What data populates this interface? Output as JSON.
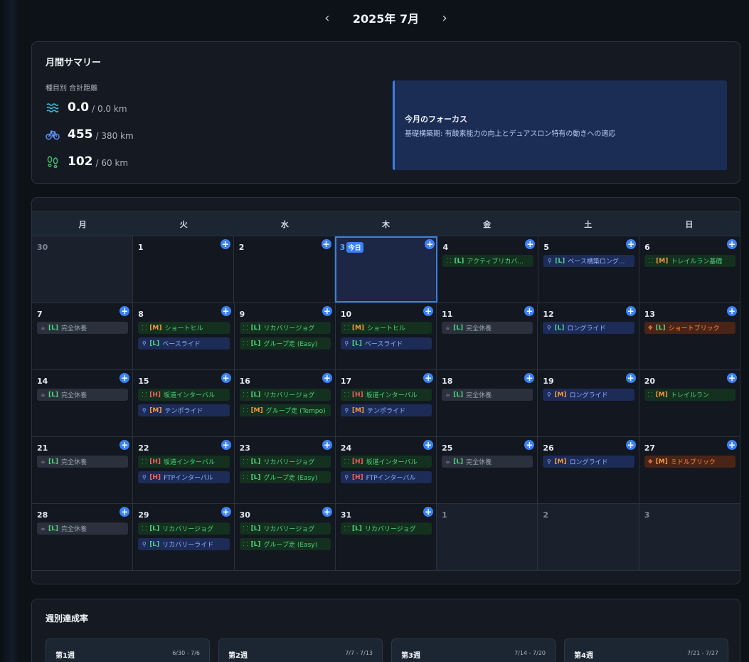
{
  "header": {
    "prev": "‹",
    "title": "2025年 7月",
    "next": "›"
  },
  "summary": {
    "title": "月間サマリー",
    "dist_label": "種目別 合計距離",
    "swim": {
      "value": "0.0",
      "target": "/ 0.0 km",
      "icon": "swim-icon"
    },
    "bike": {
      "value": "455",
      "target": "/ 380 km",
      "icon": "bike-icon"
    },
    "run": {
      "value": "102",
      "target": "/ 60 km",
      "icon": "run-icon"
    },
    "focus_title": "今月のフォーカス",
    "focus_text": "基礎構築期: 有酸素能力の向上とデュアスロン特有の動きへの適応"
  },
  "calendar": {
    "weekdays": [
      "月",
      "火",
      "水",
      "木",
      "金",
      "土",
      "日"
    ],
    "today_label": "今日",
    "add_label": "+",
    "weeks": [
      [
        {
          "num": "30",
          "other": true,
          "events": []
        },
        {
          "num": "1",
          "events": []
        },
        {
          "num": "2",
          "events": []
        },
        {
          "num": "3",
          "today": true,
          "events": []
        },
        {
          "num": "4",
          "events": [
            {
              "type": "run",
              "lvl": "[L]",
              "lv": "L",
              "name": "アクティブリカバ..."
            }
          ]
        },
        {
          "num": "5",
          "events": [
            {
              "type": "bike",
              "lvl": "[L]",
              "lv": "L",
              "name": "ベース構築ロング..."
            }
          ]
        },
        {
          "num": "6",
          "events": [
            {
              "type": "run",
              "lvl": "[M]",
              "lv": "M",
              "name": "トレイルラン基礎"
            }
          ]
        }
      ],
      [
        {
          "num": "7",
          "events": [
            {
              "type": "rest",
              "lvl": "[L]",
              "lv": "L",
              "name": "完全休養"
            }
          ]
        },
        {
          "num": "8",
          "events": [
            {
              "type": "run",
              "lvl": "[M]",
              "lv": "M",
              "name": "ショートヒル"
            },
            {
              "type": "bike",
              "lvl": "[L]",
              "lv": "L",
              "name": "ベースライド"
            }
          ]
        },
        {
          "num": "9",
          "events": [
            {
              "type": "run",
              "lvl": "[L]",
              "lv": "L",
              "name": "リカバリージョグ"
            },
            {
              "type": "run",
              "lvl": "[L]",
              "lv": "L",
              "name": "グループ走 (Easy)"
            }
          ]
        },
        {
          "num": "10",
          "events": [
            {
              "type": "run",
              "lvl": "[M]",
              "lv": "M",
              "name": "ショートヒル"
            },
            {
              "type": "bike",
              "lvl": "[L]",
              "lv": "L",
              "name": "ベースライド"
            }
          ]
        },
        {
          "num": "11",
          "events": [
            {
              "type": "rest",
              "lvl": "[L]",
              "lv": "L",
              "name": "完全休養"
            }
          ]
        },
        {
          "num": "12",
          "events": [
            {
              "type": "bike",
              "lvl": "[L]",
              "lv": "L",
              "name": "ロングライド"
            }
          ]
        },
        {
          "num": "13",
          "events": [
            {
              "type": "brick",
              "lvl": "[L]",
              "lv": "L",
              "name": "ショートブリック"
            }
          ]
        }
      ],
      [
        {
          "num": "14",
          "events": [
            {
              "type": "rest",
              "lvl": "[L]",
              "lv": "L",
              "name": "完全休養"
            }
          ]
        },
        {
          "num": "15",
          "events": [
            {
              "type": "run",
              "lvl": "[H]",
              "lv": "H",
              "name": "坂道インターバル"
            },
            {
              "type": "bike",
              "lvl": "[M]",
              "lv": "M",
              "name": "テンポライド"
            }
          ]
        },
        {
          "num": "16",
          "events": [
            {
              "type": "run",
              "lvl": "[L]",
              "lv": "L",
              "name": "リカバリージョグ"
            },
            {
              "type": "run",
              "lvl": "[M]",
              "lv": "M",
              "name": "グループ走 (Tempo)"
            }
          ]
        },
        {
          "num": "17",
          "events": [
            {
              "type": "run",
              "lvl": "[H]",
              "lv": "H",
              "name": "坂道インターバル"
            },
            {
              "type": "bike",
              "lvl": "[M]",
              "lv": "M",
              "name": "テンポライド"
            }
          ]
        },
        {
          "num": "18",
          "events": [
            {
              "type": "rest",
              "lvl": "[L]",
              "lv": "L",
              "name": "完全休養"
            }
          ]
        },
        {
          "num": "19",
          "events": [
            {
              "type": "bike",
              "lvl": "[M]",
              "lv": "M",
              "name": "ロングライド"
            }
          ]
        },
        {
          "num": "20",
          "events": [
            {
              "type": "run",
              "lvl": "[M]",
              "lv": "M",
              "name": "トレイルラン"
            }
          ]
        }
      ],
      [
        {
          "num": "21",
          "events": [
            {
              "type": "rest",
              "lvl": "[L]",
              "lv": "L",
              "name": "完全休養"
            }
          ]
        },
        {
          "num": "22",
          "events": [
            {
              "type": "run",
              "lvl": "[H]",
              "lv": "H",
              "name": "坂道インターバル"
            },
            {
              "type": "bike",
              "lvl": "[H]",
              "lv": "H",
              "name": "FTPインターバル"
            }
          ]
        },
        {
          "num": "23",
          "events": [
            {
              "type": "run",
              "lvl": "[L]",
              "lv": "L",
              "name": "リカバリージョグ"
            },
            {
              "type": "run",
              "lvl": "[L]",
              "lv": "L",
              "name": "グループ走 (Easy)"
            }
          ]
        },
        {
          "num": "24",
          "events": [
            {
              "type": "run",
              "lvl": "[H]",
              "lv": "H",
              "name": "坂道インターバル"
            },
            {
              "type": "bike",
              "lvl": "[H]",
              "lv": "H",
              "name": "FTPインターバル"
            }
          ]
        },
        {
          "num": "25",
          "events": [
            {
              "type": "rest",
              "lvl": "[L]",
              "lv": "L",
              "name": "完全休養"
            }
          ]
        },
        {
          "num": "26",
          "events": [
            {
              "type": "bike",
              "lvl": "[M]",
              "lv": "M",
              "name": "ロングライド"
            }
          ]
        },
        {
          "num": "27",
          "events": [
            {
              "type": "brick",
              "lvl": "[M]",
              "lv": "M",
              "name": "ミドルブリック"
            }
          ]
        }
      ],
      [
        {
          "num": "28",
          "events": [
            {
              "type": "rest",
              "lvl": "[L]",
              "lv": "L",
              "name": "完全休養"
            }
          ]
        },
        {
          "num": "29",
          "events": [
            {
              "type": "run",
              "lvl": "[L]",
              "lv": "L",
              "name": "リカバリージョグ"
            },
            {
              "type": "bike",
              "lvl": "[L]",
              "lv": "L",
              "name": "リカバリーライド"
            }
          ]
        },
        {
          "num": "30",
          "events": [
            {
              "type": "run",
              "lvl": "[L]",
              "lv": "L",
              "name": "リカバリージョグ"
            },
            {
              "type": "run",
              "lvl": "[L]",
              "lv": "L",
              "name": "グループ走 (Easy)"
            }
          ]
        },
        {
          "num": "31",
          "events": [
            {
              "type": "run",
              "lvl": "[L]",
              "lv": "L",
              "name": "リカバリージョグ"
            }
          ]
        },
        {
          "num": "1",
          "other": true,
          "events": []
        },
        {
          "num": "2",
          "other": true,
          "events": []
        },
        {
          "num": "3",
          "other": true,
          "events": []
        }
      ]
    ]
  },
  "weekly": {
    "title": "週別達成率",
    "weeks": [
      {
        "name": "第1週",
        "range": "6/30 - 7/6"
      },
      {
        "name": "第2週",
        "range": "7/7 - 7/13"
      },
      {
        "name": "第3週",
        "range": "7/14 - 7/20"
      },
      {
        "name": "第4週",
        "range": "7/21 - 7/27"
      }
    ]
  },
  "colors": {
    "accent": "#3b82f6",
    "run": "#4fd47e",
    "bike": "#8fb2ff",
    "brick": "#ff8a4c",
    "rest": "#9aa3ae"
  },
  "icons": {
    "run": "footprints-icon",
    "bike": "bike-icon",
    "rest": "coffee-icon",
    "brick": "brick-icon",
    "swim": "waves-icon"
  }
}
